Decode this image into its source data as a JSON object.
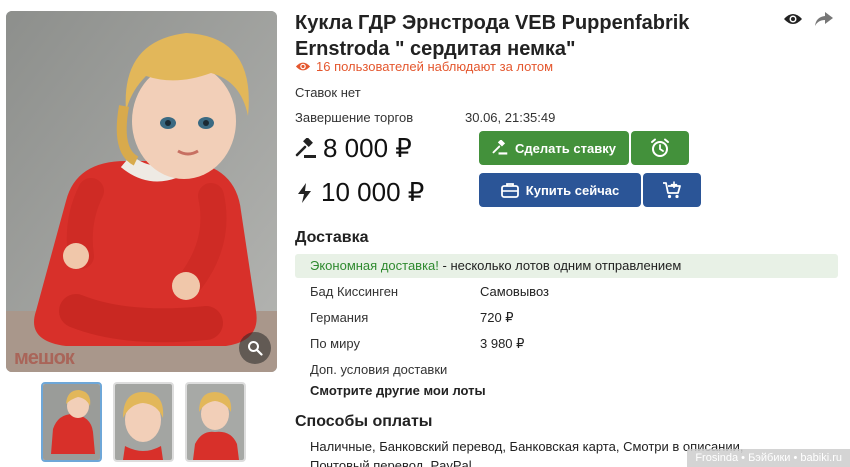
{
  "lot": {
    "title": "Кукла ГДР Эрнстрода VEB Puppenfabrik Ernstroda \" сердитая немка\"",
    "watchers": "16 пользователей наблюдают за лотом",
    "bids_status": "Ставок нет",
    "auction_end_label": "Завершение торгов",
    "auction_end_value": "30.06, 21:35:49",
    "bid_price": "8 000 ₽",
    "buy_price": "10 000 ₽"
  },
  "buttons": {
    "bid_label": "Сделать ставку",
    "buy_label": "Купить сейчас"
  },
  "delivery": {
    "title": "Доставка",
    "banner_highlight": "Экономная доставка!",
    "banner_text": " - несколько лотов одним отправлением",
    "rows": [
      {
        "label": "Бад Киссинген",
        "value": "Самовывоз"
      },
      {
        "label": "Германия",
        "value": "720 ₽"
      },
      {
        "label": "По миру",
        "value": "3 980 ₽"
      },
      {
        "label": "Доп. условия доставки",
        "value": ""
      }
    ],
    "more_lots": "Смотрите другие мои лоты"
  },
  "payment": {
    "title": "Способы оплаты",
    "methods": "Наличные, Банковский перевод, Банковская карта, Смотри в описании, Почтовый перевод, PayPal"
  },
  "gallery": {
    "watermark": "мешок",
    "thumb_count": 3
  },
  "footer": {
    "credit": "Frosinda • Бэйбики • babiki.ru"
  },
  "colors": {
    "bid_green": "#43913b",
    "buy_blue": "#2b5597",
    "watch_orange": "#e4572e",
    "banner_bg": "#e8f1e6"
  },
  "icons": [
    "eye-icon",
    "share-icon",
    "gavel-icon",
    "lightning-icon",
    "alarm-clock-icon",
    "briefcase-icon",
    "cart-plus-icon",
    "zoom-icon"
  ]
}
